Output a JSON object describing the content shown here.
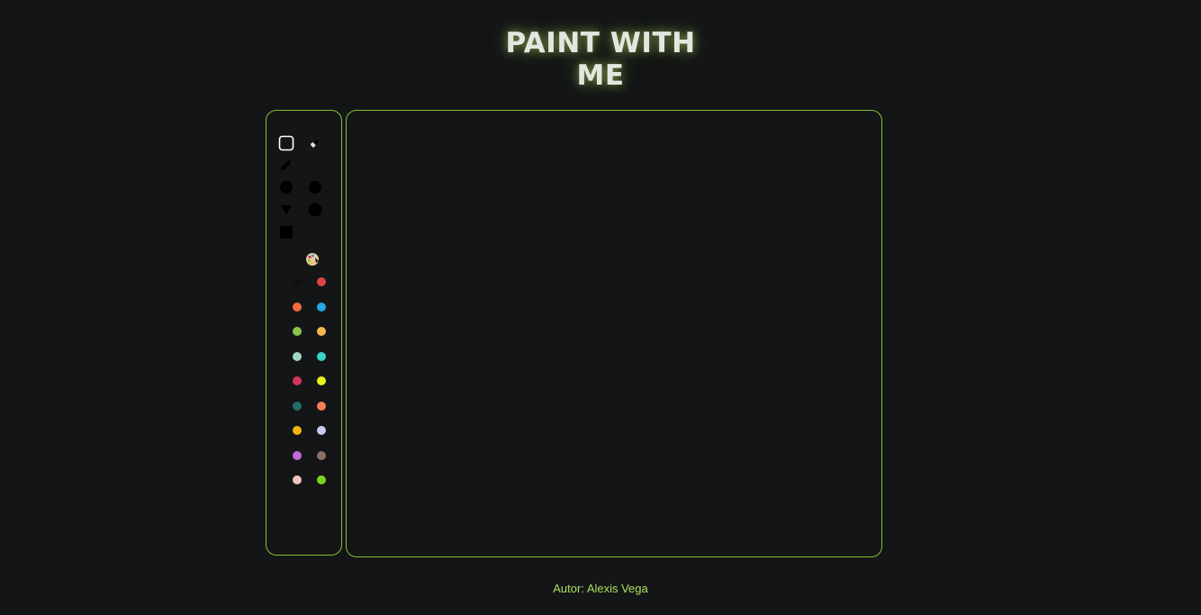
{
  "app": {
    "title_line1": "PAINT WITH",
    "title_line2": "ME",
    "footer": "Autor: Alexis Vega"
  },
  "colors": {
    "accent": "#7fc233",
    "background": "#141516",
    "footer_text": "#a8e05f"
  },
  "tools": [
    {
      "name": "select-icon",
      "selected": true
    },
    {
      "name": "eraser-icon"
    },
    {
      "name": "pencil-icon"
    },
    {
      "name": "brush-small-icon"
    },
    {
      "name": "brush-medium-icon"
    },
    {
      "name": "triangle-icon"
    },
    {
      "name": "circle-icon"
    },
    {
      "name": "square-icon"
    },
    {
      "name": "color-palette-icon"
    }
  ],
  "palette": [
    "#111111",
    "#e04444",
    "#f26b3a",
    "#21a9e1",
    "#8bc34a",
    "#f5b94d",
    "#9fd8c0",
    "#37d4c7",
    "#d6335e",
    "#e9f01d",
    "#1e6f65",
    "#f47c5a",
    "#f3b312",
    "#c8cbf2",
    "#c16ad9",
    "#8a6f67",
    "#f2c2c0",
    "#7ed11e"
  ]
}
